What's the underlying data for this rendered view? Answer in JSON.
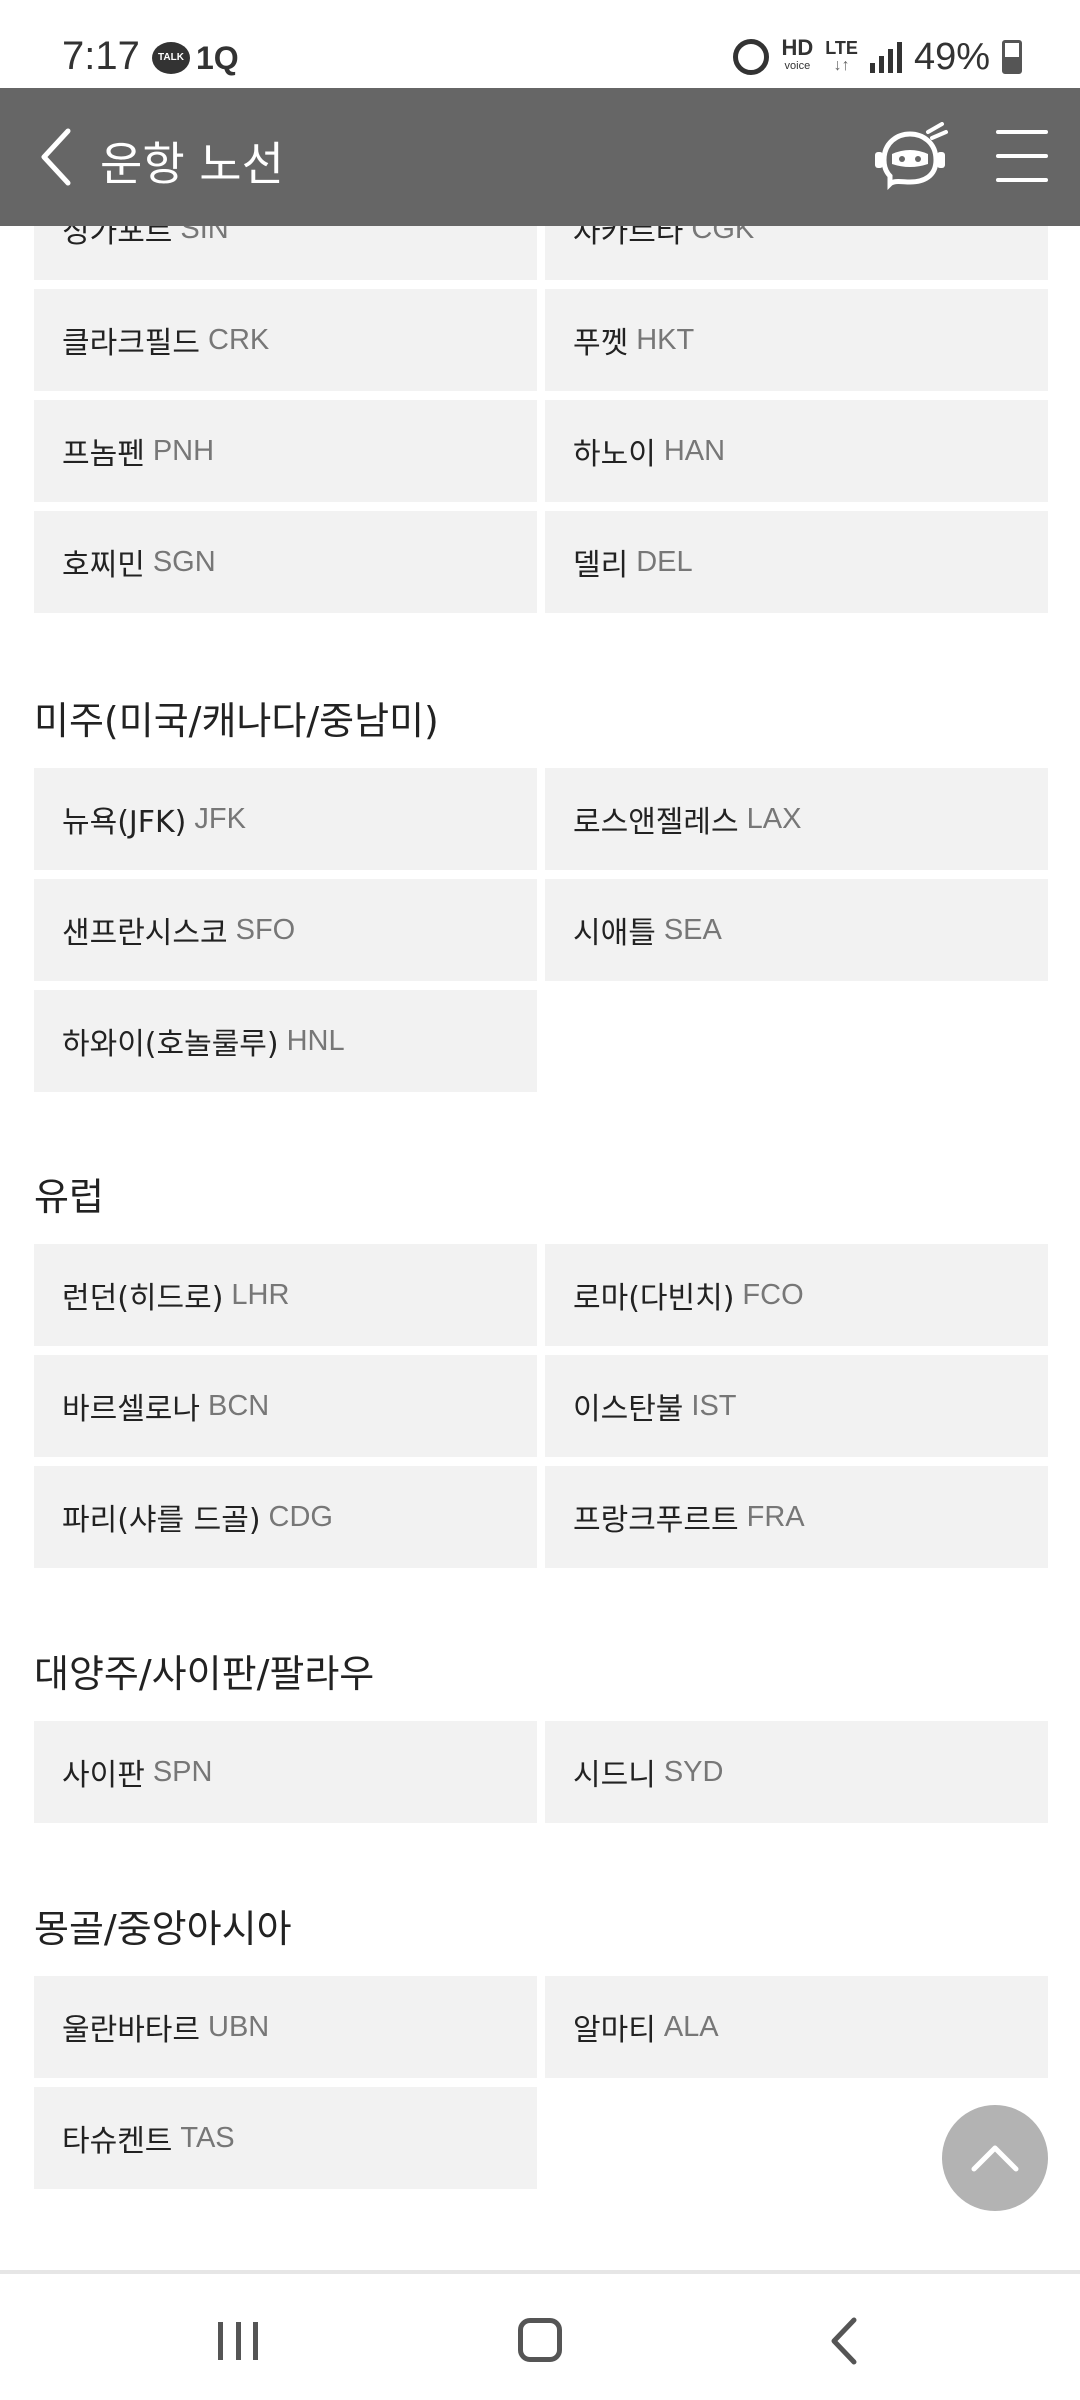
{
  "status_bar": {
    "time": "7:17",
    "talk_badge": "TALK",
    "app_badge": "1Q",
    "hd": "HD",
    "hd_sub": "voice",
    "lte": "LTE",
    "lte_sub": "↓↑",
    "battery": "49%"
  },
  "header": {
    "title": "운항 노선",
    "background_color": "#666666"
  },
  "partial_row": [
    {
      "name": "싱가포르",
      "code": "SIN"
    },
    {
      "name": "자카르타",
      "code": "CGK"
    }
  ],
  "asia_rest": [
    {
      "name": "클라크필드",
      "code": "CRK"
    },
    {
      "name": "푸껫",
      "code": "HKT"
    },
    {
      "name": "프놈펜",
      "code": "PNH"
    },
    {
      "name": "하노이",
      "code": "HAN"
    },
    {
      "name": "호찌민",
      "code": "SGN"
    },
    {
      "name": "델리",
      "code": "DEL"
    }
  ],
  "sections": [
    {
      "title": "미주(미국/캐나다/중남미)",
      "routes": [
        {
          "name": "뉴욕(JFK)",
          "code": "JFK"
        },
        {
          "name": "로스앤젤레스",
          "code": "LAX"
        },
        {
          "name": "샌프란시스코",
          "code": "SFO"
        },
        {
          "name": "시애틀",
          "code": "SEA"
        },
        {
          "name": "하와이(호놀룰루)",
          "code": "HNL"
        }
      ]
    },
    {
      "title": "유럽",
      "routes": [
        {
          "name": "런던(히드로)",
          "code": "LHR"
        },
        {
          "name": "로마(다빈치)",
          "code": "FCO"
        },
        {
          "name": "바르셀로나",
          "code": "BCN"
        },
        {
          "name": "이스탄불",
          "code": "IST"
        },
        {
          "name": "파리(샤를 드골)",
          "code": "CDG"
        },
        {
          "name": "프랑크푸르트",
          "code": "FRA"
        }
      ]
    },
    {
      "title": "대양주/사이판/팔라우",
      "routes": [
        {
          "name": "사이판",
          "code": "SPN"
        },
        {
          "name": "시드니",
          "code": "SYD"
        }
      ]
    },
    {
      "title": "몽골/중앙아시아",
      "routes": [
        {
          "name": "울란바타르",
          "code": "UBN"
        },
        {
          "name": "알마티",
          "code": "ALA"
        },
        {
          "name": "타슈켄트",
          "code": "TAS"
        }
      ]
    }
  ],
  "icons": {
    "back": "chevron-left-icon",
    "chatbot": "chatbot-icon",
    "menu": "hamburger-menu-icon",
    "scroll_top": "chevron-up-icon"
  }
}
